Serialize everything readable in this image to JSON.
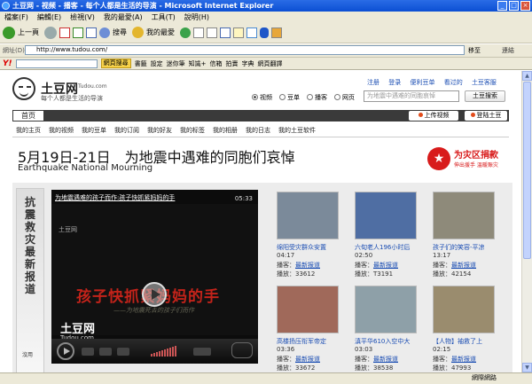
{
  "window": {
    "title": "土豆网 - 视频 - 播客 - 每个人都是生活的导演 - Microsoft Internet Explorer"
  },
  "menu": [
    "檔案(F)",
    "編輯(E)",
    "檢視(V)",
    "我的最愛(A)",
    "工具(T)",
    "說明(H)"
  ],
  "toolbar": {
    "back": "上一頁",
    "search": "搜尋",
    "favorites": "我的最愛"
  },
  "address": {
    "label": "網址(D)",
    "url": "http://www.tudou.com/",
    "go": "移至",
    "links": "連結"
  },
  "yahoo": {
    "search_btn": "網頁搜尋",
    "items": [
      "書籤",
      "設定",
      "迷你筆",
      "知識+",
      "信箱",
      "拍賣",
      "字典",
      "網頁翻譯"
    ]
  },
  "status": {
    "zone": "網際網路"
  },
  "site": {
    "logo": "土豆网",
    "domain": "Tudou.com",
    "tagline": "每个人都是生活的导演",
    "top_links": [
      "注册",
      "登录",
      "便利豆单",
      "看过的",
      "土豆客服"
    ],
    "search_options": [
      "视频",
      "豆单",
      "播客",
      "网页"
    ],
    "search_placeholder": "为地震中遇难的同胞哀悼",
    "search_button": "土豆搜索",
    "nav_home": "首页",
    "upload": "上传视频",
    "login": "登陆土豆",
    "subnav": [
      "我的主页",
      "我的视频",
      "我的豆单",
      "我的订阅",
      "我的好友",
      "我的标签",
      "我的相册",
      "我的日志",
      "我的土豆软件"
    ]
  },
  "headline": {
    "zh": "5月19日-21日　为地震中遇难的同胞们哀悼",
    "en": "Earthquake National Mourning"
  },
  "donate": {
    "title": "为灾区捐款",
    "sub": "伸出援手 温暖赈灾"
  },
  "side_banner": {
    "text": "抗震救灾最新报道",
    "foot": "沒用"
  },
  "player": {
    "title": "为地震遇难的孩子而作:孩子快抓紧妈妈的手",
    "time": "05:33",
    "watermark": "土豆网",
    "overlay": "孩子快抓紧妈妈的手",
    "overlay_sub": "——为地震死去的孩子们而作",
    "logo": "土豆网",
    "logo_domain": "Tudou.com"
  },
  "thumb_labels": {
    "uploader": "播客：",
    "plays": "播放："
  },
  "videos": [
    {
      "title": "绵阳受灾群众安置",
      "duration": "04:17",
      "uploader": "最新报道",
      "plays": "33612",
      "color": "#7b8a9a"
    },
    {
      "title": "六旬老人196小时后",
      "duration": "02:50",
      "uploader": "最新报道",
      "plays": "T3191",
      "color": "#4f6ea3"
    },
    {
      "title": "孩子们的笑容-平凉",
      "duration": "13:17",
      "uploader": "最新报道",
      "plays": "42154",
      "color": "#8e8a7a"
    },
    {
      "title": "高楼扬压衔军帝定",
      "duration": "03:36",
      "uploader": "最新报道",
      "plays": "33672",
      "color": "#a0695a"
    },
    {
      "title": "滇平华610入空中大",
      "duration": "03:03",
      "uploader": "最新报道",
      "plays": "38538",
      "color": "#8ea0a8"
    },
    {
      "title": "【人物】袖救了上",
      "duration": "02:15",
      "uploader": "最新报道",
      "plays": "47993",
      "color": "#9a8c6e"
    }
  ]
}
